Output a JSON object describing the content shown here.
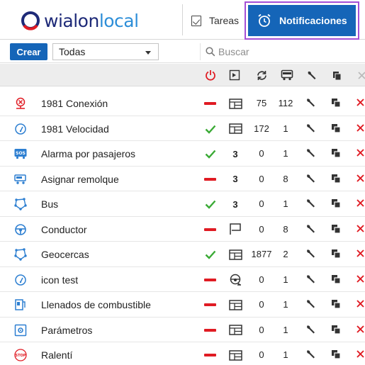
{
  "header": {
    "logo_text_a": "wialon",
    "logo_text_b": "local",
    "tab_tareas": "Tareas",
    "tab_notificaciones": "Notificaciones"
  },
  "toolbar": {
    "create_label": "Crear",
    "filter_value": "Todas",
    "search_placeholder": "Buscar"
  },
  "columns": [
    "state-power-icon",
    "type-icon",
    "refresh-icon",
    "vehicle-icon",
    "wrench-icon",
    "copy-icon",
    "delete-icon"
  ],
  "colors": {
    "accent": "#1565b8",
    "danger": "#e01b23",
    "ok": "#3aaa35",
    "highlight": "#a44fd6"
  },
  "rows": [
    {
      "name": "1981 Conexión",
      "icon": "connection-alert-icon",
      "state": "off",
      "type": "window-icon",
      "count1": "75",
      "count2": "112"
    },
    {
      "name": "1981 Velocidad",
      "icon": "speedometer-icon",
      "state": "on",
      "type": "window-icon",
      "count1": "172",
      "count2": "1"
    },
    {
      "name": "Alarma por pasajeros",
      "icon": "sos-bus-icon",
      "state": "on",
      "type": "3",
      "count1": "0",
      "count2": "1"
    },
    {
      "name": "Asignar remolque",
      "icon": "trailer-icon",
      "state": "off",
      "type": "3",
      "count1": "0",
      "count2": "8"
    },
    {
      "name": "Bus",
      "icon": "geofence-icon",
      "state": "on",
      "type": "3",
      "count1": "0",
      "count2": "1"
    },
    {
      "name": "Conductor",
      "icon": "steering-wheel-icon",
      "state": "off",
      "type": "flag-icon",
      "count1": "0",
      "count2": "8"
    },
    {
      "name": "Geocercas",
      "icon": "geofence-icon",
      "state": "on",
      "type": "window-icon",
      "count1": "1877",
      "count2": "2"
    },
    {
      "name": "icon test",
      "icon": "speedometer-icon",
      "state": "off",
      "type": "driver-icon",
      "count1": "0",
      "count2": "1"
    },
    {
      "name": "Llenados de combustible",
      "icon": "fuel-icon",
      "state": "off",
      "type": "window-icon",
      "count1": "0",
      "count2": "1"
    },
    {
      "name": "Parámetros",
      "icon": "parameters-icon",
      "state": "off",
      "type": "window-icon",
      "count1": "0",
      "count2": "1"
    },
    {
      "name": "Ralentí",
      "icon": "stop-icon",
      "state": "off",
      "type": "window-icon",
      "count1": "0",
      "count2": "1"
    }
  ]
}
